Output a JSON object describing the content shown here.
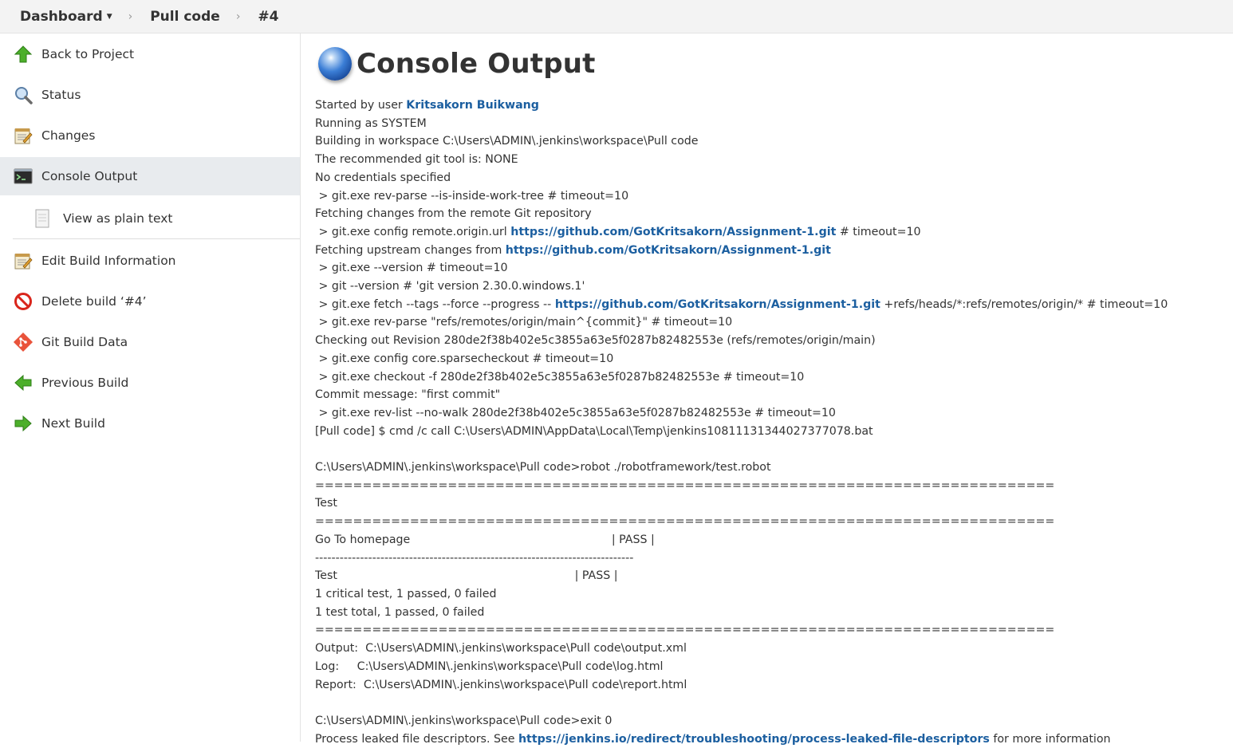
{
  "breadcrumb": {
    "items": [
      "Dashboard",
      "Pull code",
      "#4"
    ],
    "separator": "›"
  },
  "sidebar": {
    "items": [
      {
        "label": "Back to Project",
        "icon": "up-arrow-icon"
      },
      {
        "label": "Status",
        "icon": "magnifier-icon"
      },
      {
        "label": "Changes",
        "icon": "notepad-icon"
      },
      {
        "label": "Console Output",
        "icon": "terminal-icon",
        "active": true
      },
      {
        "label": "View as plain text",
        "icon": "document-icon",
        "sub": true
      },
      {
        "label": "Edit Build Information",
        "icon": "notepad-edit-icon"
      },
      {
        "label": "Delete build ‘#4’",
        "icon": "no-entry-icon"
      },
      {
        "label": "Git Build Data",
        "icon": "git-icon"
      },
      {
        "label": "Previous Build",
        "icon": "left-arrow-icon"
      },
      {
        "label": "Next Build",
        "icon": "right-arrow-icon"
      }
    ]
  },
  "page": {
    "title": "Console Output"
  },
  "console": {
    "started_by_prefix": "Started by user ",
    "user": "Kritsakorn Buikwang",
    "repo_url": "https://github.com/GotKritsakorn/Assignment-1.git",
    "leak_url": "https://jenkins.io/redirect/troubleshooting/process-leaked-file-descriptors",
    "lines_a": [
      "Running as SYSTEM",
      "Building in workspace C:\\Users\\ADMIN\\.jenkins\\workspace\\Pull code",
      "The recommended git tool is: NONE",
      "No credentials specified",
      " > git.exe rev-parse --is-inside-work-tree # timeout=10",
      "Fetching changes from the remote Git repository"
    ],
    "config_prefix": " > git.exe config remote.origin.url ",
    "config_suffix": " # timeout=10",
    "fetch_upstream_prefix": "Fetching upstream changes from ",
    "lines_b": [
      " > git.exe --version # timeout=10",
      " > git --version # 'git version 2.30.0.windows.1'"
    ],
    "fetch_prefix": " > git.exe fetch --tags --force --progress -- ",
    "fetch_suffix": " +refs/heads/*:refs/remotes/origin/* # timeout=10",
    "lines_c": [
      " > git.exe rev-parse \"refs/remotes/origin/main^{commit}\" # timeout=10",
      "Checking out Revision 280de2f38b402e5c3855a63e5f0287b82482553e (refs/remotes/origin/main)",
      " > git.exe config core.sparsecheckout # timeout=10",
      " > git.exe checkout -f 280de2f38b402e5c3855a63e5f0287b82482553e # timeout=10",
      "Commit message: \"first commit\"",
      " > git.exe rev-list --no-walk 280de2f38b402e5c3855a63e5f0287b82482553e # timeout=10",
      "[Pull code] $ cmd /c call C:\\Users\\ADMIN\\AppData\\Local\\Temp\\jenkins10811131344027377078.bat",
      "",
      "C:\\Users\\ADMIN\\.jenkins\\workspace\\Pull code>robot ./robotframework/test.robot",
      "==============================================================================",
      "Test",
      "==============================================================================",
      "Go To homepage                                                        | PASS |",
      "------------------------------------------------------------------------------",
      "Test                                                                  | PASS |",
      "1 critical test, 1 passed, 0 failed",
      "1 test total, 1 passed, 0 failed",
      "==============================================================================",
      "Output:  C:\\Users\\ADMIN\\.jenkins\\workspace\\Pull code\\output.xml",
      "Log:     C:\\Users\\ADMIN\\.jenkins\\workspace\\Pull code\\log.html",
      "Report:  C:\\Users\\ADMIN\\.jenkins\\workspace\\Pull code\\report.html",
      "",
      "C:\\Users\\ADMIN\\.jenkins\\workspace\\Pull code>exit 0"
    ],
    "leak_prefix": "Process leaked file descriptors. See ",
    "leak_suffix": " for more information"
  }
}
